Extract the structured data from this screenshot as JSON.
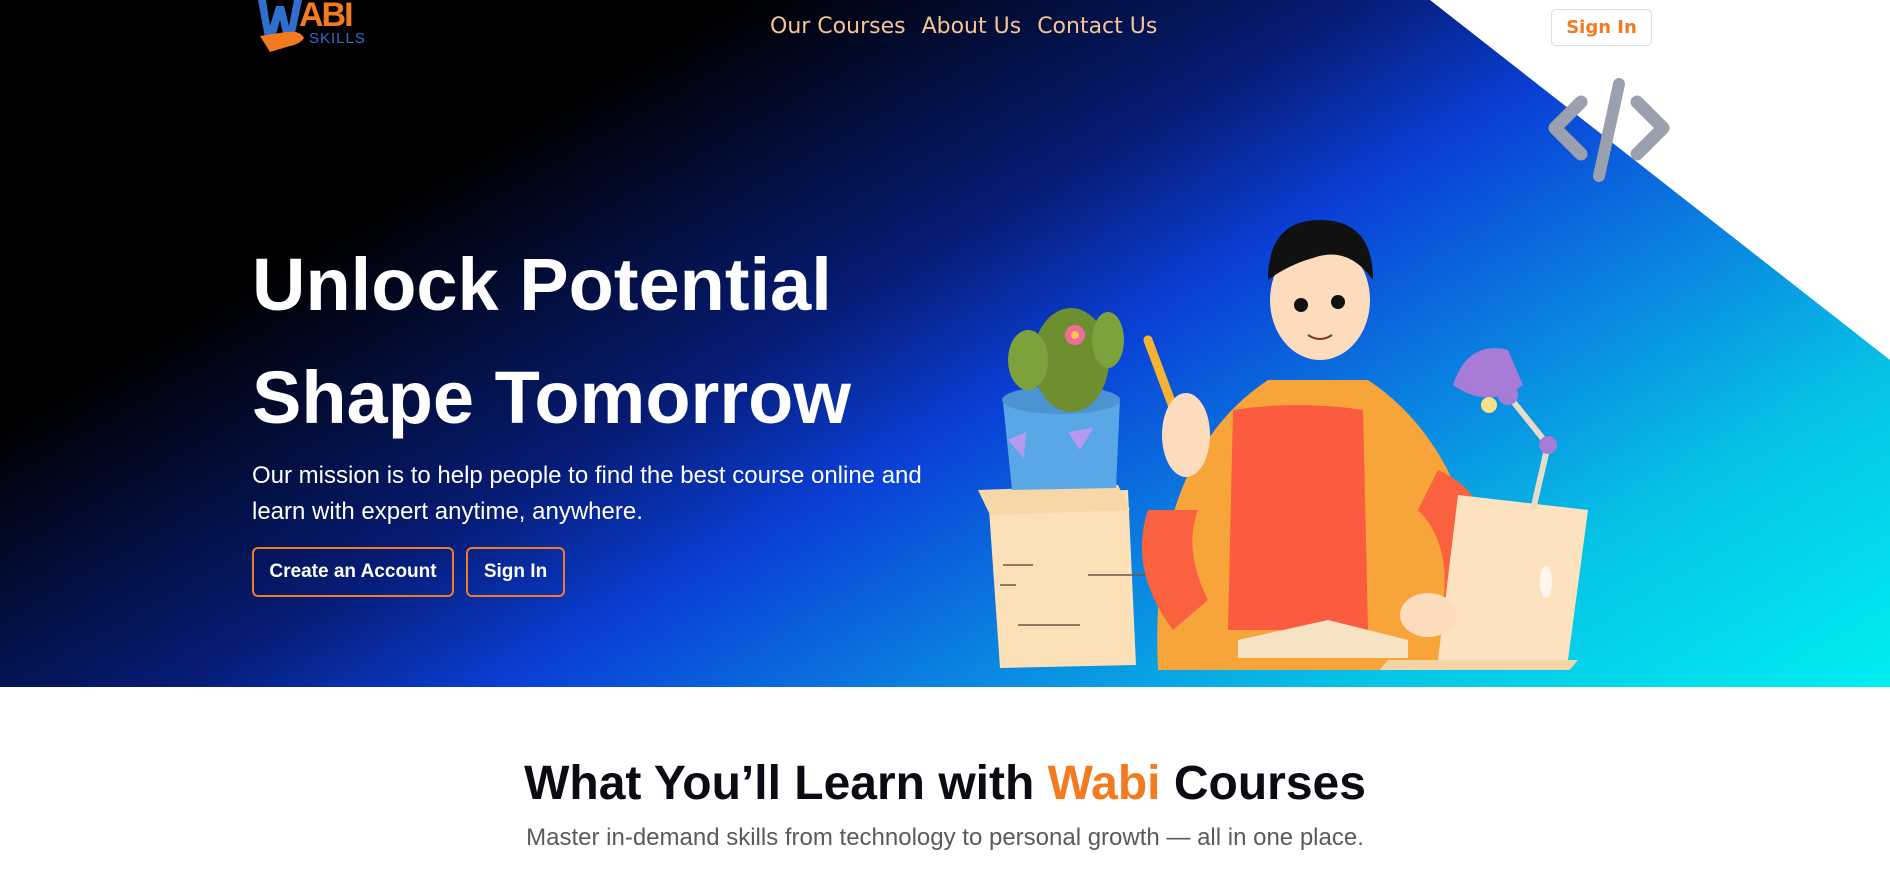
{
  "colors": {
    "accent": "#f47a20",
    "nav_link": "#f7c493",
    "hero_text": "#ffffff",
    "heading_dark": "#0b0b14",
    "subtext": "#5a5a5a"
  },
  "logo": {
    "text_main": "ABI",
    "text_sub": "SKILLS",
    "icon": "w-hand-logo-icon"
  },
  "nav": {
    "links": [
      "Our Courses",
      "About Us",
      "Contact Us"
    ],
    "signin_label": "Sign In"
  },
  "hero": {
    "title_line1": "Unlock Potential",
    "title_line2": "Shape Tomorrow",
    "description": "Our mission is to help people to find the best course online and learn with expert anytime, anywhere.",
    "create_account_label": "Create an Account",
    "signin_label": "Sign In",
    "illustration": "student-studying-illustration",
    "code_icon": "code-brackets-icon"
  },
  "section": {
    "title_before": "What You’ll Learn with ",
    "title_accent": "Wabi",
    "title_after": " Courses",
    "subtitle": "Master in-demand skills from technology to personal growth — all in one place."
  }
}
